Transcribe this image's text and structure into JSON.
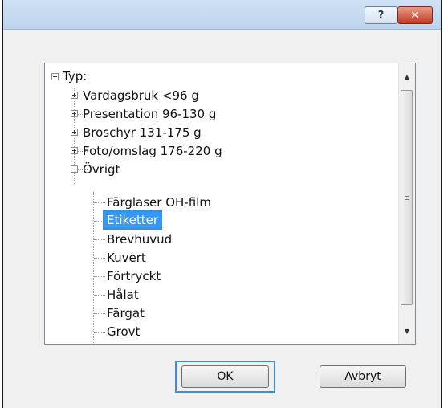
{
  "titlebar": {
    "help_label": "?",
    "close_label": "✕"
  },
  "tree": {
    "root": "Typ:",
    "items": [
      "Vardagsbruk <96 g",
      "Presentation 96-130 g",
      "Broschyr 131-175 g",
      "Foto/omslag 176-220 g",
      "Övrigt"
    ],
    "subitems": [
      "Färglaser OH-film",
      "Etiketter",
      "Brevhuvud",
      "Kuvert",
      "Förtryckt",
      "Hålat",
      "Färgat",
      "Grovt"
    ],
    "selected": "Etiketter"
  },
  "buttons": {
    "ok": "OK",
    "cancel": "Avbryt"
  },
  "colors": {
    "selection": "#3399ff",
    "focus_border": "#3d8fd3",
    "close_button": "#c13d23",
    "titlebar": "#c6dbf1"
  }
}
